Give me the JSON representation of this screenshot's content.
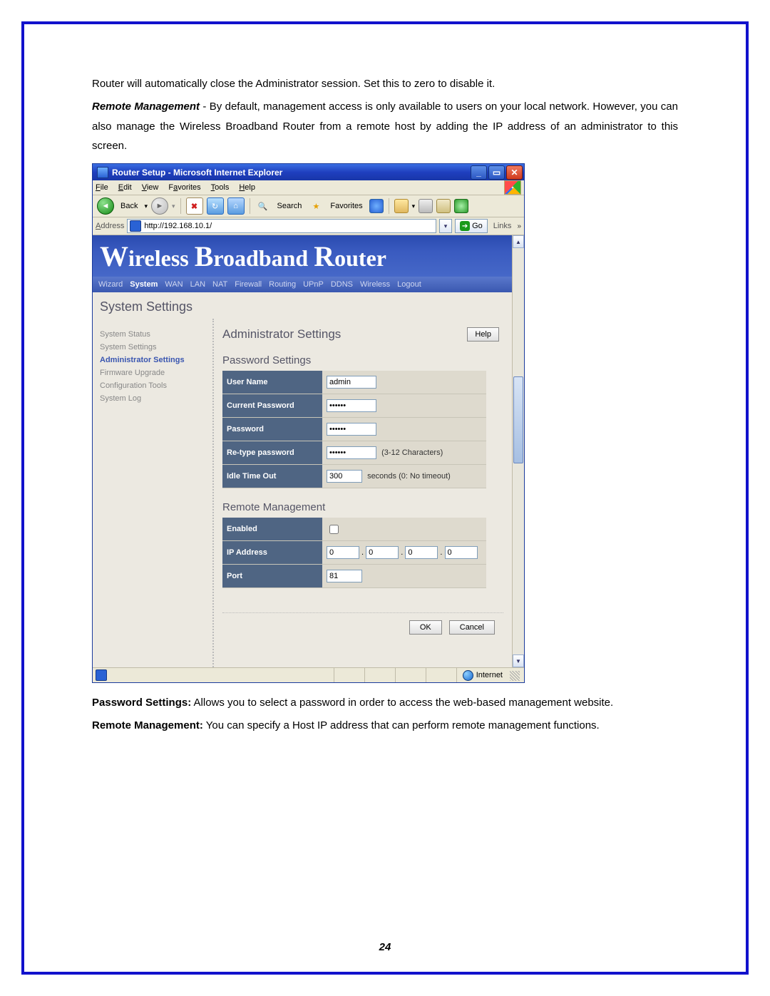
{
  "doc": {
    "intro1": "Router will automatically close the Administrator session. Set this to zero to disable it.",
    "remote_mgmt_label": "Remote Management",
    "remote_mgmt_text": " - By default, management access is only available to users on your local network. However, you can also manage the Wireless Broadband Router from a remote host by adding the IP address of an administrator to this screen.",
    "pwd_label": "Password Settings:",
    "pwd_text": " Allows you to select a password in order to access the web-based management website.",
    "rm_label2": "Remote Management:",
    "rm_text2": " You can specify a Host IP address that can perform remote management functions.",
    "page_number": "24"
  },
  "browser": {
    "title": "Router Setup - Microsoft Internet Explorer",
    "menus": [
      "File",
      "Edit",
      "View",
      "Favorites",
      "Tools",
      "Help"
    ],
    "back": "Back",
    "search": "Search",
    "favorites": "Favorites",
    "address_label": "Address",
    "url": "http://192.168.10.1/",
    "go": "Go",
    "links": "Links",
    "status_zone": "Internet"
  },
  "router": {
    "brand": [
      "W",
      "ireless ",
      "B",
      "roadband ",
      "R",
      "outer"
    ],
    "topnav": [
      "Wizard",
      "System",
      "WAN",
      "LAN",
      "NAT",
      "Firewall",
      "Routing",
      "UPnP",
      "DDNS",
      "Wireless",
      "Logout"
    ],
    "topnav_selected": "System",
    "page_title": "System Settings",
    "sidebar": [
      {
        "label": "System Status"
      },
      {
        "label": "System Settings"
      },
      {
        "label": "Administrator Settings",
        "active": true
      },
      {
        "label": "Firmware Upgrade"
      },
      {
        "label": "Configuration Tools"
      },
      {
        "label": "System Log"
      }
    ],
    "content": {
      "title": "Administrator Settings",
      "help": "Help",
      "pwd_section": "Password Settings",
      "fields": {
        "user_name_label": "User Name",
        "user_name_value": "admin",
        "curr_pwd_label": "Current Password",
        "curr_pwd_value": "••••••",
        "pwd_label": "Password",
        "pwd_value": "••••••",
        "retype_label": "Re-type password",
        "retype_value": "••••••",
        "retype_hint": "(3-12 Characters)",
        "idle_label": "Idle Time Out",
        "idle_value": "300",
        "idle_hint": "seconds (0: No timeout)"
      },
      "rm_section": "Remote Management",
      "rm": {
        "enabled_label": "Enabled",
        "ip_label": "IP Address",
        "ip": [
          "0",
          "0",
          "0",
          "0"
        ],
        "port_label": "Port",
        "port_value": "81"
      },
      "ok": "OK",
      "cancel": "Cancel"
    }
  }
}
